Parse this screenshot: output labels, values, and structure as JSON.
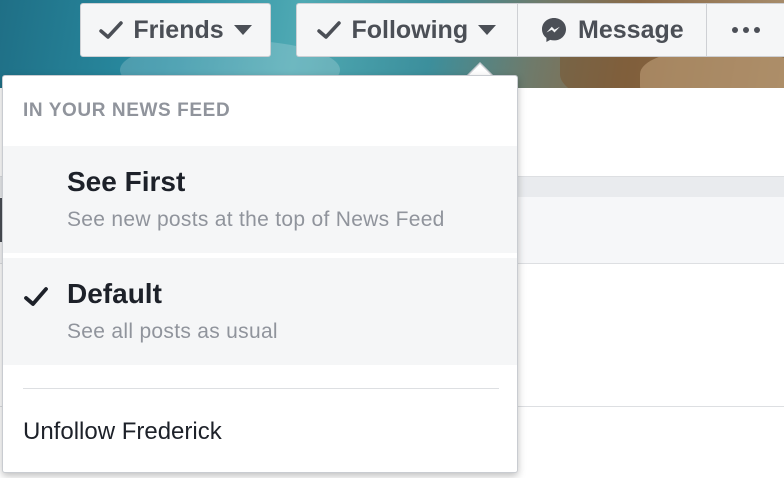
{
  "profile_actions": {
    "friends_label": "Friends",
    "following_label": "Following",
    "message_label": "Message",
    "more_icon": "more-dots-icon"
  },
  "follow_menu": {
    "section_header": "IN YOUR NEWS FEED",
    "options": [
      {
        "title": "See First",
        "subtitle": "See new posts at the top of News Feed",
        "selected": false
      },
      {
        "title": "Default",
        "subtitle": "See all posts as usual",
        "selected": true
      }
    ],
    "unfollow_label": "Unfollow Frederick"
  },
  "colors": {
    "button_bg": "#f5f6f7",
    "button_text": "#4b4f56",
    "option_bg": "#f5f6f7",
    "header_text": "#90949c",
    "title_text": "#1d2129"
  },
  "icons": {
    "friends": "check-icon",
    "following": "check-icon",
    "message": "messenger-icon",
    "dropdown": "caret-down-icon",
    "selected": "check-icon"
  }
}
